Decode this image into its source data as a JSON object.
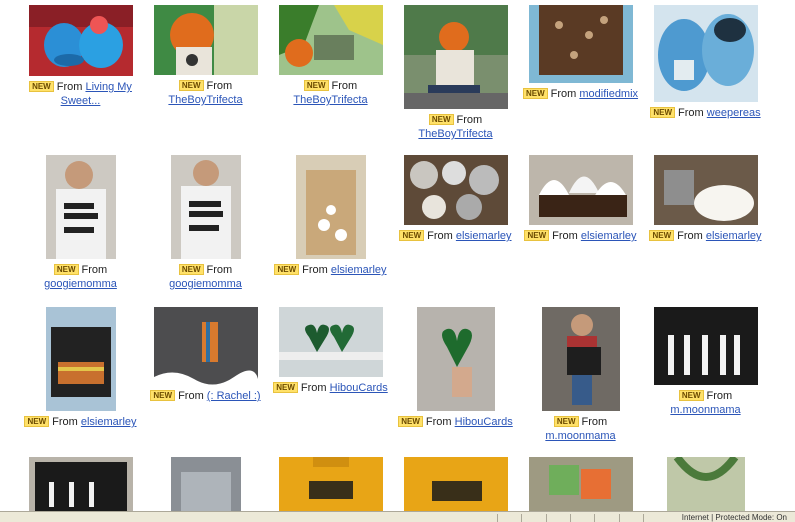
{
  "new_label": "NEW",
  "from_label": "From",
  "items": [
    {
      "user": "Living My Sweet...",
      "img": "blue-slippers"
    },
    {
      "user": "TheBoyTrifecta",
      "img": "child-hat-graffiti"
    },
    {
      "user": "TheBoyTrifecta",
      "img": "child-graffiti"
    },
    {
      "user": "TheBoyTrifecta",
      "img": "child-sitting"
    },
    {
      "user": "modifiedmix",
      "img": "brown-pants"
    },
    {
      "user": "weepereas",
      "img": "baby-shoes"
    },
    {
      "user": "googiemomma",
      "img": "boy-tshirt-1"
    },
    {
      "user": "googiemomma",
      "img": "boy-tshirt-2"
    },
    {
      "user": "elsiemarley",
      "img": "gift-bag"
    },
    {
      "user": "elsiemarley",
      "img": "baking-ingredients"
    },
    {
      "user": "elsiemarley",
      "img": "cupcakes"
    },
    {
      "user": "elsiemarley",
      "img": "whipped-cream"
    },
    {
      "user": "elsiemarley",
      "img": "car-trunk"
    },
    {
      "user": "(: Rachel :)",
      "img": "grey-shirt"
    },
    {
      "user": "HibouCards",
      "img": "green-hearts"
    },
    {
      "user": "HibouCards",
      "img": "green-heart-hand"
    },
    {
      "user": "m.moonmama",
      "img": "boy-mail-bag"
    },
    {
      "user": "m.moonmama",
      "img": "mail-bag"
    },
    {
      "user": "",
      "img": "mail-bag-2"
    },
    {
      "user": "",
      "img": "grey-bag"
    },
    {
      "user": "",
      "img": "oui-shirt"
    },
    {
      "user": "",
      "img": "non-shirt"
    },
    {
      "user": "",
      "img": "toy-blocks"
    },
    {
      "user": "",
      "img": "green-bag"
    }
  ],
  "status": {
    "zone": "Internet | Protected Mode: On"
  }
}
